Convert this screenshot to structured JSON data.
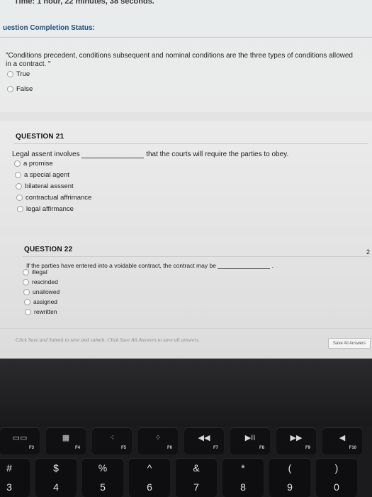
{
  "timer_text": "Time: 1 hour, 22 minutes, 38 seconds.",
  "status_label": "uestion Completion Status:",
  "q20": {
    "text_line1": "\"Conditions precedent, conditions subsequent and nominal conditions are the three types of conditions allowed",
    "text_line2": "in a contract. \"",
    "options": [
      "True",
      "False"
    ]
  },
  "q21": {
    "header": "QUESTION 21",
    "text_before": "Legal assent involves",
    "text_after": "that the courts will require the parties to obey.",
    "options": [
      "a promise",
      "a special agent",
      "bilateral asssent",
      "contractual affrimance",
      "legal affirmance"
    ]
  },
  "q22": {
    "header": "QUESTION 22",
    "text_before": "If the parties have entered into a voidable contract, the contract may be",
    "text_after": ".",
    "points": "2",
    "options": [
      "illegal",
      "rescinded",
      "unallowed",
      "assigned",
      "rewritten"
    ]
  },
  "footer": {
    "save_message": "Click Save and Submit to save and submit. Click Save All Answers to save all answers.",
    "save_all_button": "Save All Answers"
  },
  "keyboard": {
    "function_keys": [
      {
        "label": "F3",
        "icon": "mission-control-icon",
        "glyph": "▭▭"
      },
      {
        "label": "F4",
        "icon": "launchpad-icon",
        "glyph": "▦"
      },
      {
        "label": "F5",
        "icon": "keyboard-dim-icon",
        "glyph": "⁖"
      },
      {
        "label": "F6",
        "icon": "keyboard-bright-icon",
        "glyph": "⁘"
      },
      {
        "label": "F7",
        "icon": "rewind-icon",
        "glyph": "◀◀"
      },
      {
        "label": "F8",
        "icon": "play-pause-icon",
        "glyph": "▶II"
      },
      {
        "label": "F9",
        "icon": "fast-forward-icon",
        "glyph": "▶▶"
      },
      {
        "label": "F10",
        "icon": "mute-icon",
        "glyph": "◀"
      }
    ],
    "number_keys": [
      {
        "symbol": "#",
        "number": "3"
      },
      {
        "symbol": "$",
        "number": "4"
      },
      {
        "symbol": "%",
        "number": "5"
      },
      {
        "symbol": "^",
        "number": "6"
      },
      {
        "symbol": "&",
        "number": "7"
      },
      {
        "symbol": "*",
        "number": "8"
      },
      {
        "symbol": "(",
        "number": "9"
      },
      {
        "symbol": ")",
        "number": "0"
      }
    ]
  }
}
